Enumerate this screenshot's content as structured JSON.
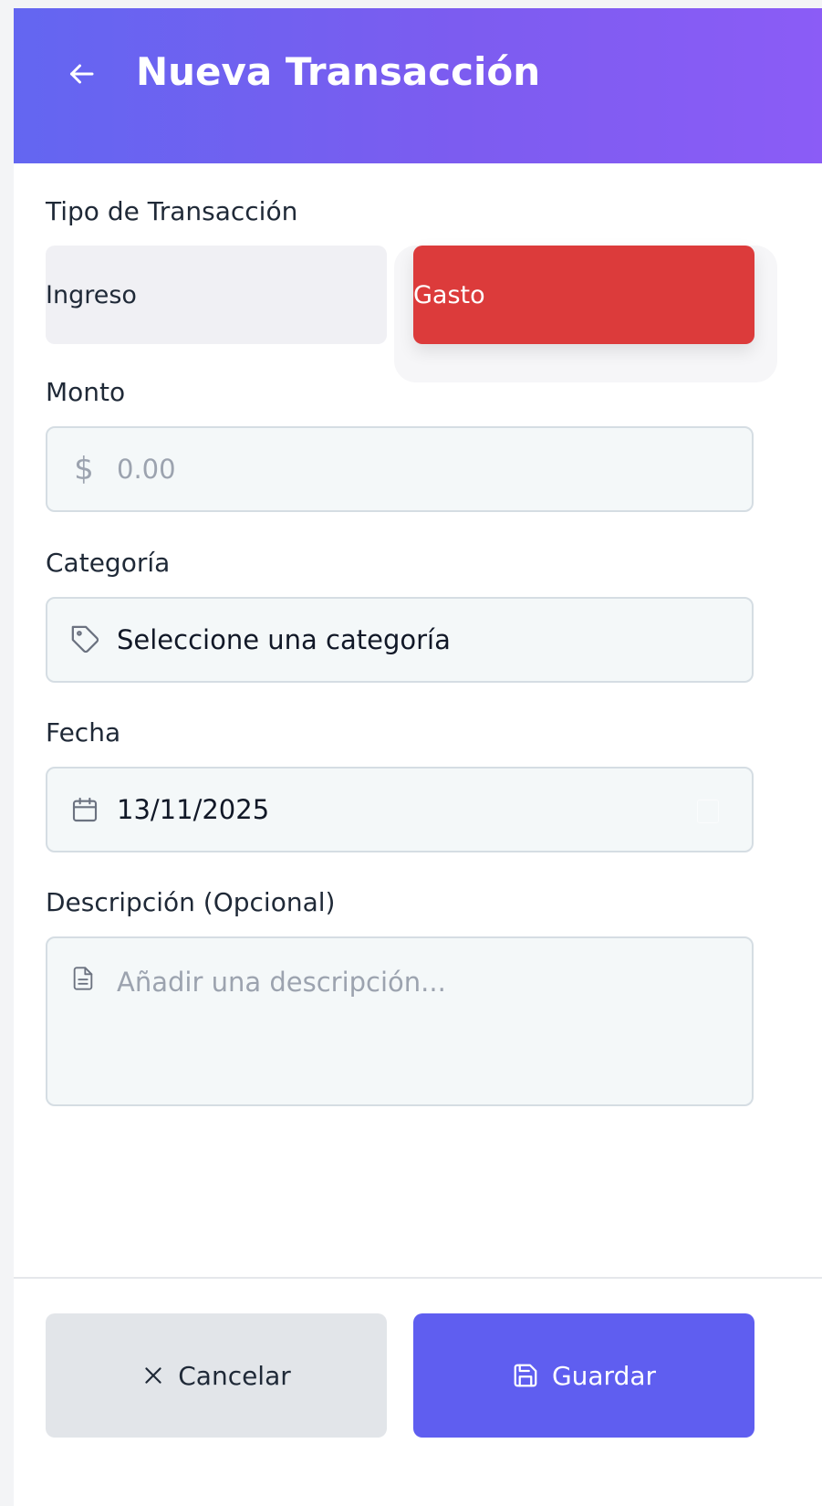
{
  "header": {
    "title": "Nueva Transacción",
    "background_from": "#6366f1",
    "background_to": "#8b5cf6"
  },
  "transaction_type": {
    "label": "Tipo de Transacción",
    "options": [
      {
        "label": "Ingreso",
        "selected": false
      },
      {
        "label": "Gasto",
        "selected": true,
        "color": "#dc3b3b"
      }
    ]
  },
  "amount": {
    "label": "Monto",
    "icon": "dollar-icon",
    "currency_symbol": "$",
    "placeholder": "0.00",
    "value": ""
  },
  "category": {
    "label": "Categoría",
    "icon": "tag-icon",
    "value": "Seleccione una categoría"
  },
  "date": {
    "label": "Fecha",
    "icon": "calendar-icon",
    "value": "13/11/2025"
  },
  "description": {
    "label": "Descripción (Opcional)",
    "icon": "document-icon",
    "placeholder": "Añadir una descripción...",
    "value": ""
  },
  "footer": {
    "cancel_label": "Cancelar",
    "save_label": "Guardar",
    "save_color": "#5f5ef0"
  }
}
